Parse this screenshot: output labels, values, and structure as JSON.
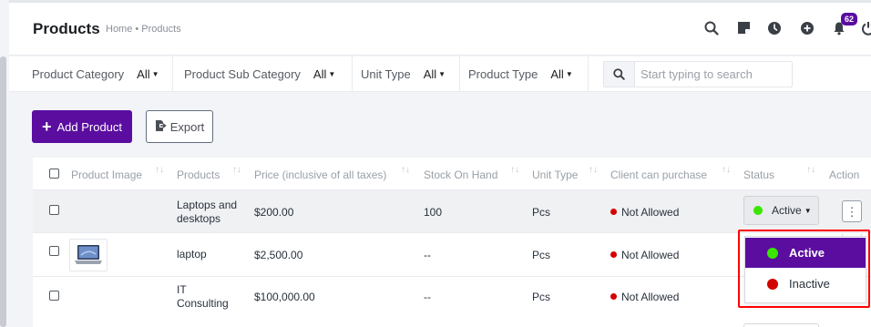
{
  "header": {
    "title": "Products",
    "breadcrumb": "Home • Products",
    "notification_count": "62",
    "icons": [
      "search-icon",
      "sticky-note-icon",
      "clock-icon",
      "plus-circle-icon",
      "bell-icon",
      "power-icon"
    ]
  },
  "filters": {
    "product_category": {
      "label": "Product Category",
      "value": "All"
    },
    "product_sub_category": {
      "label": "Product Sub Category",
      "value": "All"
    },
    "unit_type": {
      "label": "Unit Type",
      "value": "All"
    },
    "product_type": {
      "label": "Product Type",
      "value": "All"
    },
    "search_placeholder": "Start typing to search"
  },
  "actions": {
    "add_product": "Add Product",
    "export": "Export"
  },
  "table": {
    "columns": [
      "Product Image",
      "Products",
      "Price (inclusive of all taxes)",
      "Stock On Hand",
      "Unit Type",
      "Client can purchase",
      "Status",
      "Action"
    ],
    "rows": [
      {
        "name_line1": "Laptops and",
        "name_line2": "desktops",
        "price": "$200.00",
        "stock": "100",
        "unit": "Pcs",
        "client": "Not Allowed",
        "status": "Active",
        "has_image": false
      },
      {
        "name_line1": "laptop",
        "name_line2": "",
        "price": "$2,500.00",
        "stock": "--",
        "unit": "Pcs",
        "client": "Not Allowed",
        "status": "",
        "has_image": true
      },
      {
        "name_line1": "IT",
        "name_line2": "Consulting",
        "price": "$100,000.00",
        "stock": "--",
        "unit": "Pcs",
        "client": "Not Allowed",
        "status": "",
        "has_image": false
      }
    ]
  },
  "status_dropdown": {
    "options": [
      {
        "label": "Active",
        "color": "#39e600",
        "selected": true
      },
      {
        "label": "Inactive",
        "color": "#d30000",
        "selected": false
      }
    ]
  },
  "colors": {
    "accent": "#5a0d9f",
    "highlight_box": "#ff0000",
    "not_allowed": "#d30000",
    "active": "#39e600"
  }
}
